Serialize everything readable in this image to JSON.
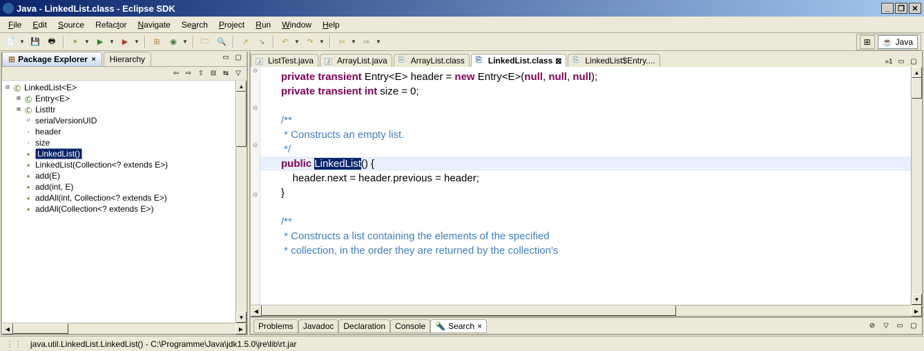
{
  "window": {
    "title": "Java - LinkedList.class - Eclipse SDK"
  },
  "menu": {
    "items": [
      "File",
      "Edit",
      "Source",
      "Refactor",
      "Navigate",
      "Search",
      "Project",
      "Run",
      "Window",
      "Help"
    ],
    "mnemonics": [
      "F",
      "E",
      "S",
      "t",
      "N",
      "a",
      "P",
      "R",
      "W",
      "H"
    ]
  },
  "perspective": {
    "label": "Java"
  },
  "leftPanel": {
    "tabs": [
      {
        "label": "Package Explorer",
        "active": true,
        "closable": true
      },
      {
        "label": "Hierarchy",
        "active": false
      }
    ],
    "tree": [
      {
        "depth": 0,
        "expand": "-",
        "iconType": "class-green",
        "label": "LinkedList<E>"
      },
      {
        "depth": 1,
        "expand": "+",
        "iconType": "class-green",
        "label": "Entry<E>"
      },
      {
        "depth": 1,
        "expand": "+",
        "iconType": "class-green",
        "label": "ListItr"
      },
      {
        "depth": 1,
        "expand": "",
        "iconType": "field-static",
        "label": "serialVersionUID"
      },
      {
        "depth": 1,
        "expand": "",
        "iconType": "field",
        "label": "header"
      },
      {
        "depth": 1,
        "expand": "",
        "iconType": "field",
        "label": "size"
      },
      {
        "depth": 1,
        "expand": "",
        "iconType": "method",
        "label": "LinkedList()",
        "selected": true
      },
      {
        "depth": 1,
        "expand": "",
        "iconType": "method",
        "label": "LinkedList(Collection<? extends E>)"
      },
      {
        "depth": 1,
        "expand": "",
        "iconType": "method",
        "label": "add(E)"
      },
      {
        "depth": 1,
        "expand": "",
        "iconType": "method",
        "label": "add(int, E)"
      },
      {
        "depth": 1,
        "expand": "",
        "iconType": "method",
        "label": "addAll(int, Collection<? extends E>)"
      },
      {
        "depth": 1,
        "expand": "",
        "iconType": "method",
        "label": "addAll(Collection<? extends E>)"
      }
    ]
  },
  "editor": {
    "tabs": [
      {
        "label": "ListTest.java",
        "icon": "java",
        "active": false
      },
      {
        "label": "ArrayList.java",
        "icon": "java",
        "active": false
      },
      {
        "label": "ArrayList.class",
        "icon": "class",
        "active": false
      },
      {
        "label": "LinkedList.class",
        "icon": "class",
        "active": true,
        "closable": true
      },
      {
        "label": "LinkedList$Entry....",
        "icon": "class",
        "active": false
      }
    ],
    "overflow": "»1",
    "code": {
      "lines": [
        {
          "kind": "code",
          "t": "private transient Entry<E> header = new Entry<E>(null, null, null);"
        },
        {
          "kind": "code",
          "t": "private transient int size = 0;"
        },
        {
          "kind": "blank",
          "t": ""
        },
        {
          "kind": "comment",
          "t": "/**"
        },
        {
          "kind": "comment",
          "t": " * Constructs an empty list."
        },
        {
          "kind": "comment",
          "t": " */"
        },
        {
          "kind": "hl",
          "t": "public LinkedList() {"
        },
        {
          "kind": "code2",
          "t": "    header.next = header.previous = header;"
        },
        {
          "kind": "code",
          "t": "}"
        },
        {
          "kind": "blank",
          "t": ""
        },
        {
          "kind": "comment",
          "t": "/**"
        },
        {
          "kind": "comment",
          "t": " * Constructs a list containing the elements of the specified"
        },
        {
          "kind": "comment",
          "t": " * collection, in the order they are returned by the collection's"
        }
      ],
      "highlightWord": "LinkedList"
    }
  },
  "bottomViews": {
    "tabs": [
      "Problems",
      "Javadoc",
      "Declaration",
      "Console"
    ],
    "activeTab": "Search"
  },
  "statusBar": {
    "text": "java.util.LinkedList.LinkedList() - C:\\Programme\\Java\\jdk1.5.0\\jre\\lib\\rt.jar"
  },
  "colors": {
    "keyword": "#7f0055",
    "comment": "#3f7fbf",
    "titlebar_left": "#0a246a",
    "titlebar_right": "#a6caf0",
    "selection": "#0a246a"
  }
}
